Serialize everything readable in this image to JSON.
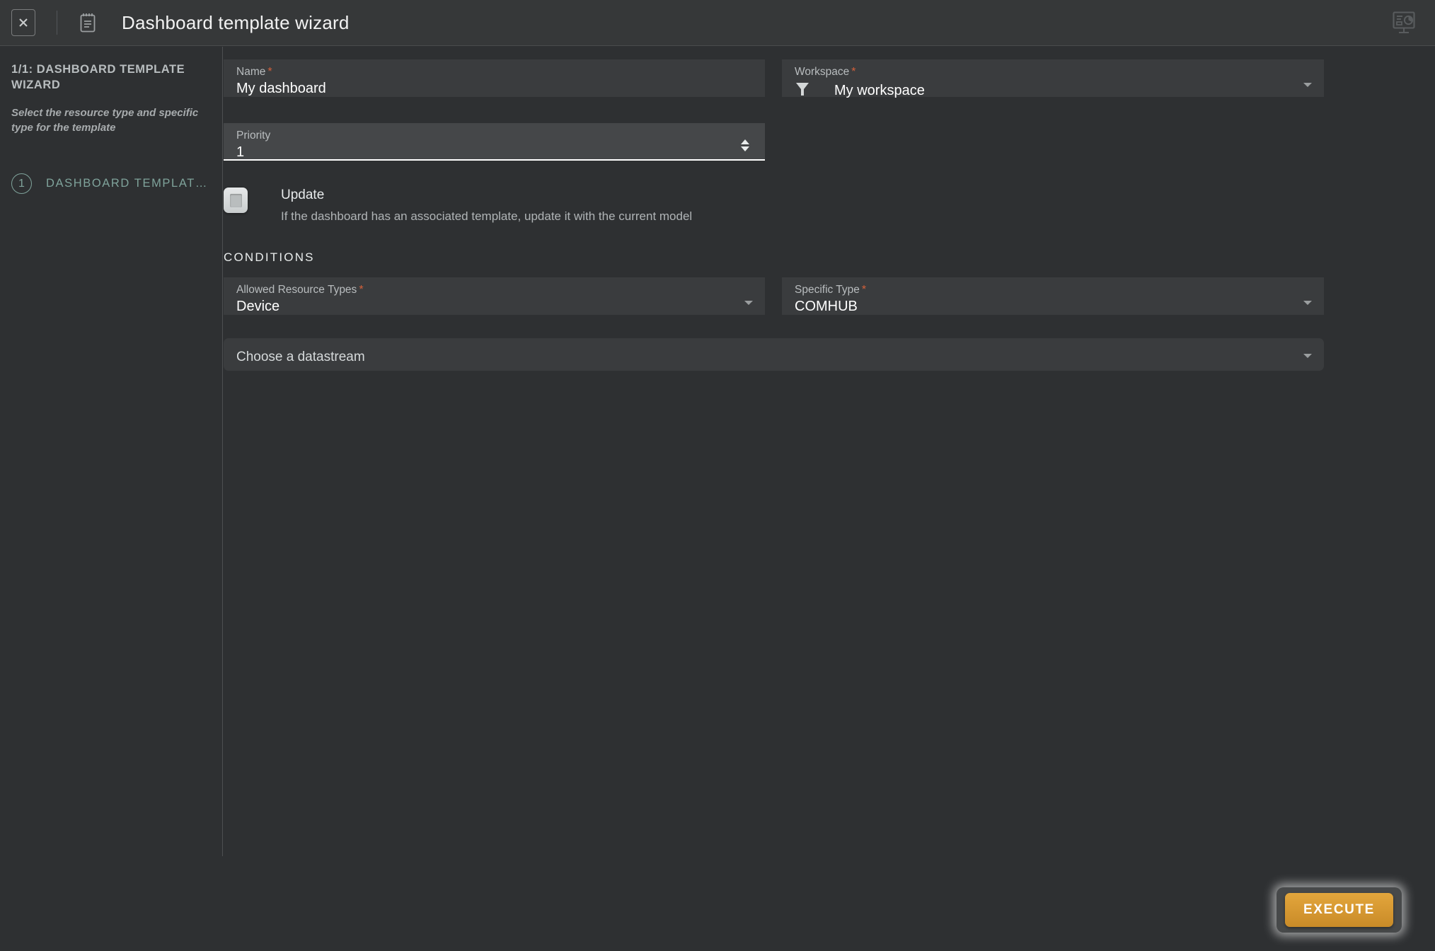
{
  "titlebar": {
    "close_icon": "close-x-icon",
    "doc_icon": "notepad-icon",
    "title": "Dashboard template wizard",
    "right_icon": "dashboard-monitor-icon"
  },
  "sidebar": {
    "step_title": "1/1: DASHBOARD TEMPLATE WIZARD",
    "step_description": "Select the resource type and specific type for the template",
    "steps": [
      {
        "number": "1",
        "label": "DASHBOARD TEMPLAT…"
      }
    ]
  },
  "form": {
    "name": {
      "label": "Name",
      "required": "*",
      "value": "My dashboard"
    },
    "workspace": {
      "label": "Workspace",
      "required": "*",
      "value": "My workspace",
      "icon": "funnel-filter-icon"
    },
    "priority": {
      "label": "Priority",
      "value": "1"
    },
    "update": {
      "title": "Update",
      "description": "If the dashboard has an associated template, update it with the current model",
      "checked": false
    },
    "conditions_heading": "CONDITIONS",
    "allowed_resource_types": {
      "label": "Allowed Resource Types",
      "required": "*",
      "value": "Device"
    },
    "specific_type": {
      "label": "Specific Type",
      "required": "*",
      "value": "COMHUB"
    },
    "datastream": {
      "placeholder": "Choose a datastream"
    }
  },
  "footer": {
    "execute_label": "EXECUTE"
  },
  "colors": {
    "background": "#2e3032",
    "topbar": "#363839",
    "field": "#3a3c3e",
    "field_focused": "#454749",
    "accent_step": "#7fa39b",
    "required_marker": "#d4603a",
    "execute_button": "#d9a036"
  }
}
